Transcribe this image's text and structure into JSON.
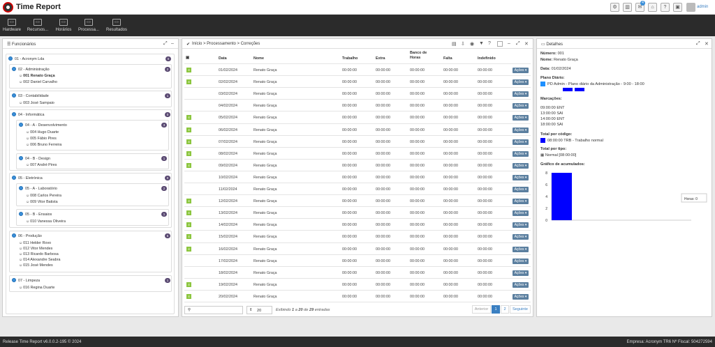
{
  "app": {
    "title": "Time Report",
    "user": "admin",
    "notifications": "4"
  },
  "menu": [
    {
      "label": "Hardware",
      "icon": "hardware-icon"
    },
    {
      "label": "Recursos...",
      "icon": "resources-icon"
    },
    {
      "label": "Horários",
      "icon": "schedule-icon"
    },
    {
      "label": "Processa...",
      "icon": "processing-icon"
    },
    {
      "label": "Resultados",
      "icon": "results-icon"
    }
  ],
  "left": {
    "title": "Funcionários",
    "nodes": [
      {
        "label": "01 - Acronym Lda",
        "count": "0"
      },
      {
        "label": "02 - Administração",
        "count": "2"
      },
      {
        "label": "03 - Contabilidade",
        "count": "1"
      },
      {
        "label": "04 - Informática",
        "count": "0"
      },
      {
        "label": "04 - A - Desenvolvimento",
        "count": "3"
      },
      {
        "label": "04 - B - Design",
        "count": "1"
      },
      {
        "label": "05 - Eletrónica",
        "count": "0"
      },
      {
        "label": "05 - A - Laboratório",
        "count": "2"
      },
      {
        "label": "05 - B - Ensaios",
        "count": "1"
      },
      {
        "label": "06 - Produção",
        "count": "5"
      },
      {
        "label": "07 - Limpeza",
        "count": "1"
      }
    ],
    "employees": [
      "001 Renato Graça",
      "002 Daniel Carvalho",
      "003 José Sampaio",
      "004 Hugo Duarte",
      "005 Fábio Pires",
      "006 Bruno Ferreira",
      "007 André Pires",
      "008 Carlos Pereira",
      "009 Vitor Batista",
      "010 Vanessa Oliveira",
      "011 Helder Rovo",
      "012 Vitor Mendes",
      "013 Ricardo Barbosa",
      "014 Alexandre Seabra",
      "015 José Mendes",
      "016 Regina Duarte"
    ]
  },
  "center": {
    "breadcrumb": "Início > Processamento > Correções",
    "columns": [
      "Data",
      "Nome",
      "Trabalho",
      "Extra",
      "Banco de Horas",
      "Falta",
      "Indefinido"
    ],
    "rows": [
      {
        "flag": "4",
        "date": "01/02/2024"
      },
      {
        "flag": "4",
        "date": "02/02/2024"
      },
      {
        "flag": "",
        "date": "03/02/2024"
      },
      {
        "flag": "",
        "date": "04/02/2024"
      },
      {
        "flag": "4",
        "date": "05/02/2024"
      },
      {
        "flag": "4",
        "date": "06/02/2024"
      },
      {
        "flag": "4",
        "date": "07/02/2024"
      },
      {
        "flag": "4",
        "date": "08/02/2024"
      },
      {
        "flag": "4",
        "date": "09/02/2024"
      },
      {
        "flag": "",
        "date": "10/02/2024"
      },
      {
        "flag": "",
        "date": "11/02/2024"
      },
      {
        "flag": "4",
        "date": "12/02/2024"
      },
      {
        "flag": "4",
        "date": "13/02/2024"
      },
      {
        "flag": "4",
        "date": "14/02/2024"
      },
      {
        "flag": "4",
        "date": "15/02/2024"
      },
      {
        "flag": "4",
        "date": "16/02/2024"
      },
      {
        "flag": "",
        "date": "17/02/2024"
      },
      {
        "flag": "",
        "date": "18/02/2024"
      },
      {
        "flag": "4",
        "date": "19/02/2024"
      },
      {
        "flag": "4",
        "date": "20/02/2024"
      }
    ],
    "row_name": "Renato Graça",
    "row_time": "00:00:00",
    "actions_label": "Ações ▾",
    "page_size": "20",
    "info_prefix": "Exibindo ",
    "info_from": "1",
    "info_mid": " a ",
    "info_to": "20",
    "info_de": " de ",
    "info_total": "29",
    "info_suffix": " entradas",
    "pagination": {
      "prev": "Anterior",
      "p1": "1",
      "p2": "2",
      "next": "Seguinte"
    }
  },
  "right": {
    "title": "Detalhes",
    "numero_label": "Número:",
    "numero": "001",
    "nome_label": "Nome:",
    "nome": "Renato Graça",
    "data_label": "Data:",
    "data": "01/02/2024",
    "plano_label": "Plano Diário:",
    "plano": "PD Admin - Plano diário da Administração - 9:00 - 18:00",
    "marcacoes_label": "Marcações:",
    "marcacoes": [
      "09:00:00 ENT",
      "13:00:00 SAI",
      "14:00:00 ENT",
      "18:00:00 SAI"
    ],
    "total_codigo_label": "Total por código:",
    "total_codigo": "08:00:00 TRB - Trabalho normal",
    "total_tipo_label": "Total por tipo:",
    "total_tipo": "Normal [08:00:00]",
    "grafico_label": "Gráfico de acumulados:",
    "accent": "#0000ff"
  },
  "chart_data": {
    "type": "bar",
    "series": [
      {
        "name": "Horas",
        "values": [
          8
        ]
      }
    ],
    "yticks": [
      "0",
      "2",
      "4",
      "6",
      "8"
    ],
    "ylim": [
      0,
      8
    ],
    "legend": "Horas: 0"
  },
  "footer": {
    "left": "Release Time Report v6.0.0.2-195 © 2024",
    "right": "Empresa: Acronym TR6 Nº Fiscal: 504272594"
  }
}
